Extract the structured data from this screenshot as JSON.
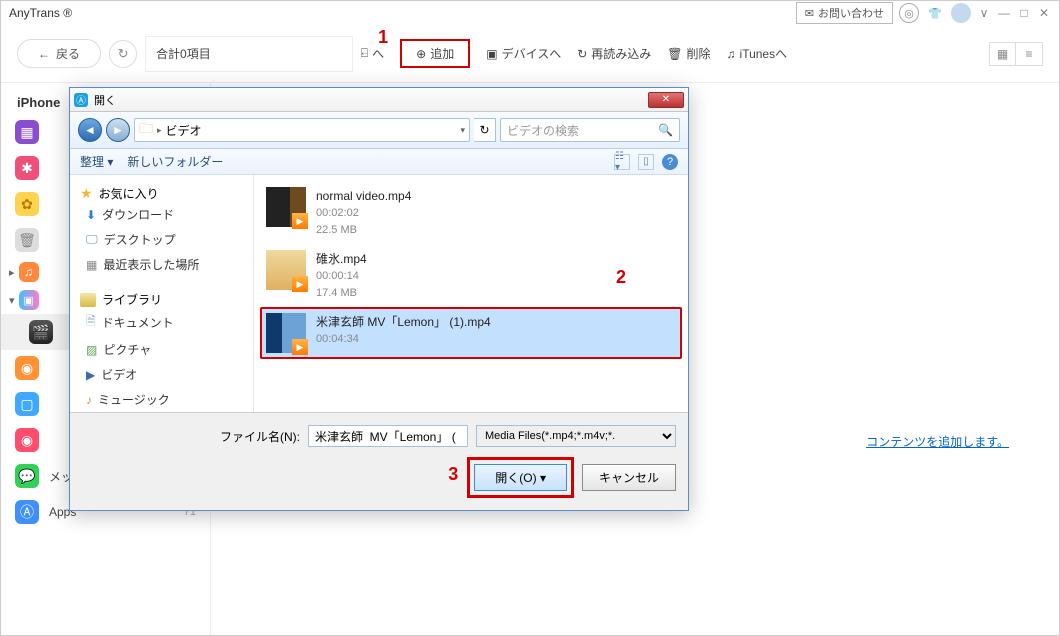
{
  "topbar": {
    "title": "AnyTrans ®",
    "contact": "お問い合わせ"
  },
  "toolbar": {
    "back": "戻る",
    "summary": "合計0項目",
    "add": "追加",
    "device": "デバイスへ",
    "reload": "再読み込み",
    "delete": "削除",
    "itunes": "iTunesへ"
  },
  "sidebar": {
    "device_name": "iPhone",
    "message": "メッセージ",
    "message_count": "--",
    "apps": "Apps",
    "apps_count": "71"
  },
  "content": {
    "hint_link": "コンテンツを追加します。"
  },
  "dialog": {
    "title": "開く",
    "breadcrumb": "ビデオ",
    "search_placeholder": "ビデオの検索",
    "organize": "整理",
    "new_folder": "新しいフォルダー",
    "tree": {
      "favorites": "お気に入り",
      "downloads": "ダウンロード",
      "desktop": "デスクトップ",
      "recent": "最近表示した場所",
      "library": "ライブラリ",
      "documents": "ドキュメント",
      "pictures": "ピクチャ",
      "videos": "ビデオ",
      "music": "ミュージック"
    },
    "files": [
      {
        "name": "normal video.mp4",
        "dur": "00:02:02",
        "size": "22.5 MB"
      },
      {
        "name": "碓氷.mp4",
        "dur": "00:00:14",
        "size": "17.4 MB"
      },
      {
        "name": "米津玄師  MV「Lemon」 (1).mp4",
        "dur": "00:04:34",
        "size": ""
      }
    ],
    "filename_label": "ファイル名(N):",
    "filename_value": "米津玄師  MV「Lemon」 (",
    "filter": "Media Files(*.mp4;*.m4v;*.",
    "open_btn": "開く(O)",
    "cancel_btn": "キャンセル"
  },
  "markers": {
    "m1": "1",
    "m2": "2",
    "m3": "3"
  }
}
